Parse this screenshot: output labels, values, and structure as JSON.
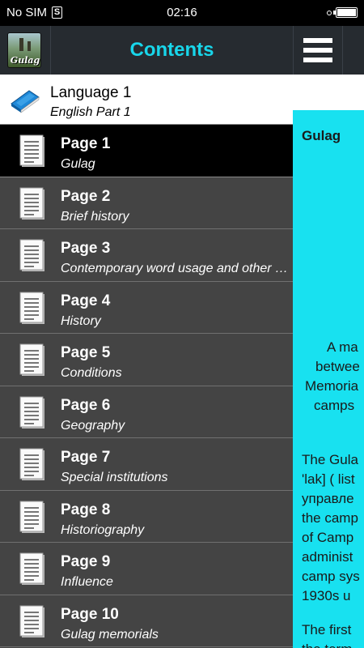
{
  "status_bar": {
    "carrier": "No SIM",
    "sim_glyph": "S",
    "time": "02:16"
  },
  "drawer": {
    "app_logo_text": "Gulag",
    "title": "Contents",
    "language": {
      "title": "Language 1",
      "subtitle": "English Part 1"
    },
    "pages": [
      {
        "title": "Page 1",
        "subtitle": "Gulag",
        "selected": true
      },
      {
        "title": "Page 2",
        "subtitle": "Brief history",
        "selected": false
      },
      {
        "title": "Page 3",
        "subtitle": "Contemporary word usage and other meanings",
        "selected": false
      },
      {
        "title": "Page 4",
        "subtitle": "History",
        "selected": false
      },
      {
        "title": "Page 5",
        "subtitle": "Conditions",
        "selected": false
      },
      {
        "title": "Page 6",
        "subtitle": "Geography",
        "selected": false
      },
      {
        "title": "Page 7",
        "subtitle": "Special institutions",
        "selected": false
      },
      {
        "title": "Page 8",
        "subtitle": "Historiography",
        "selected": false
      },
      {
        "title": "Page 9",
        "subtitle": "Influence",
        "selected": false
      },
      {
        "title": "Page 10",
        "subtitle": "Gulag memorials",
        "selected": false
      }
    ]
  },
  "content": {
    "heading": "Gulag",
    "caption_lines": [
      "A ma",
      "betwee",
      "Memoria",
      "camps"
    ],
    "paragraph1_lines": [
      "The Gula",
      "'lak] ( list",
      "управле",
      "the camp",
      "of Camp",
      "administ",
      "camp sys",
      "1930s u"
    ],
    "paragraph2_lines": [
      "The first",
      "the term"
    ]
  },
  "colors": {
    "accent": "#18d6ea",
    "content_bg": "#18e1f0",
    "drawer_bg": "#444444",
    "toolbar_bg": "#262b30"
  }
}
